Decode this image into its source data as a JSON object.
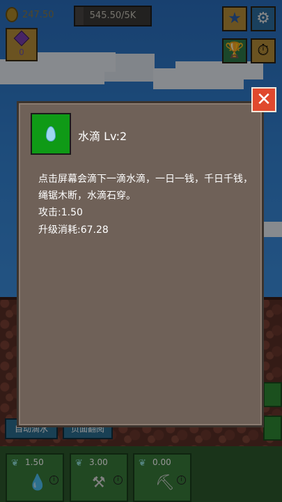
{
  "hud": {
    "gold": "247.50",
    "progress_text": "545.50/5K",
    "progress_fraction": 0.109,
    "gems": "0",
    "buttons": [
      {
        "name": "star",
        "icon": "★"
      },
      {
        "name": "settings",
        "icon": "⚙"
      },
      {
        "name": "trophy",
        "icon": "🏆"
      },
      {
        "name": "clock",
        "icon": "⏱"
      }
    ]
  },
  "modal": {
    "title": "水滴 Lv:2",
    "description": "点击屏幕会滴下一滴水滴，一日一钱，千日千钱，绳锯木断，水滴石穿。",
    "attack": "攻击:1.50",
    "upgrade_cost": "升级消耗:67.28",
    "close_glyph": "✕"
  },
  "bottom": {
    "tab_left": "自动滴水",
    "tab_right": "页面翻阅",
    "cards": [
      {
        "value": "1.50",
        "tool": "💧"
      },
      {
        "value": "3.00",
        "tool": "⚒"
      },
      {
        "value": "0.00",
        "tool": "⛏"
      }
    ],
    "info_glyph": "i",
    "leaf_glyph": "❦"
  },
  "colors": {
    "modal_bg": "#6f6158",
    "item_icon_bg": "#0f9a16",
    "close_bg": "#e0492e"
  }
}
